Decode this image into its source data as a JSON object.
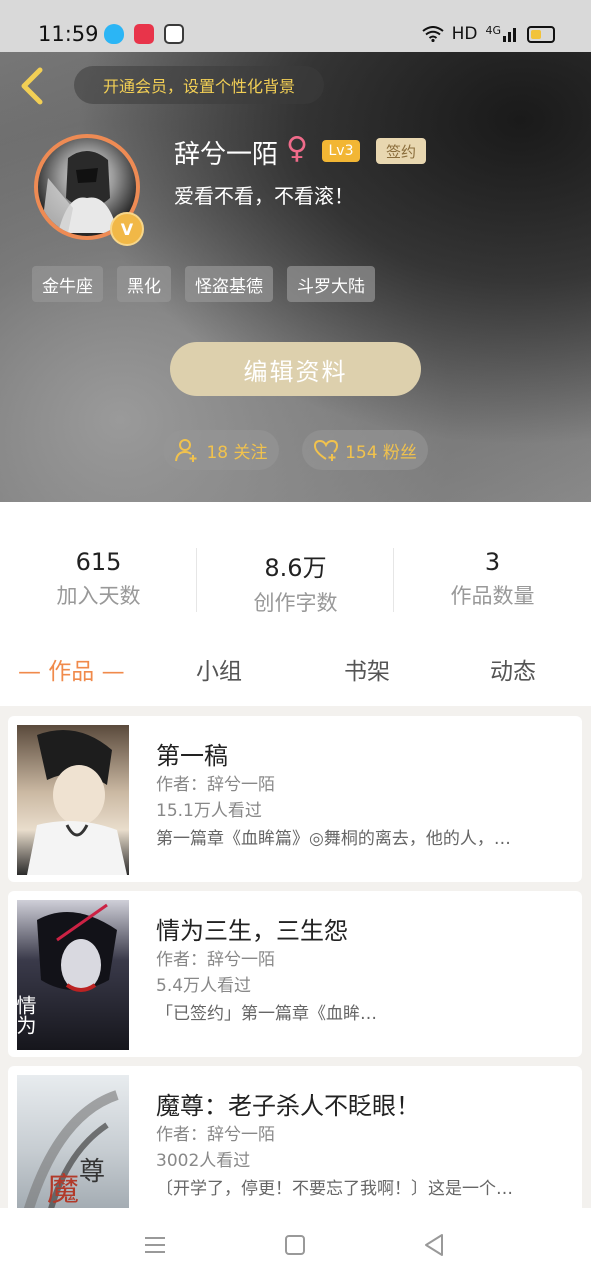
{
  "status": {
    "time": "11:59",
    "network": "HD",
    "signal": "4G",
    "app_icons": [
      "qq-icon",
      "video-app-icon",
      "wallet-app-icon"
    ],
    "battery_color": "#f2c33a"
  },
  "header": {
    "vip_prompt": "开通会员，设置个性化背景",
    "back_icon": "chevron-left-icon"
  },
  "profile": {
    "name": "辞兮一陌",
    "gender": "♀",
    "level": "Lv3",
    "sign_badge": "签约",
    "verified": "V",
    "bio": "爱看不看，不看滚！",
    "tags": [
      "金牛座",
      "黑化",
      "怪盗基德",
      "斗罗大陆"
    ],
    "edit_label": "编辑资料",
    "following": "18 关注",
    "fans": "154 粉丝"
  },
  "stats": [
    {
      "value": "615",
      "label": "加入天数"
    },
    {
      "value": "8.6万",
      "label": "创作字数"
    },
    {
      "value": "3",
      "label": "作品数量"
    }
  ],
  "tabs": [
    {
      "label": "— 作品 —",
      "active": true
    },
    {
      "label": "小组",
      "active": false
    },
    {
      "label": "书架",
      "active": false
    },
    {
      "label": "动态",
      "active": false
    }
  ],
  "works": [
    {
      "title": "第一稿",
      "author": "作者：辞兮一陌",
      "views": "15.1万人看过",
      "desc": "第一篇章《血眸篇》◎舞桐的离去，他的人，…"
    },
    {
      "title": "情为三生，三生怨",
      "author": "作者：辞兮一陌",
      "views": "5.4万人看过",
      "desc": "「已签约」第一篇章《血眸…"
    },
    {
      "title": "魔尊：老子杀人不眨眼！",
      "author": "作者：辞兮一陌",
      "views": "3002人看过",
      "desc": "〔开学了，停更！不要忘了我啊！〕这是一个…"
    }
  ],
  "covers": {
    "c2_text": "情为三生 三生怨",
    "c3_text": "魔尊"
  },
  "accent": "#f08a4b",
  "gold": "#f2cf55"
}
